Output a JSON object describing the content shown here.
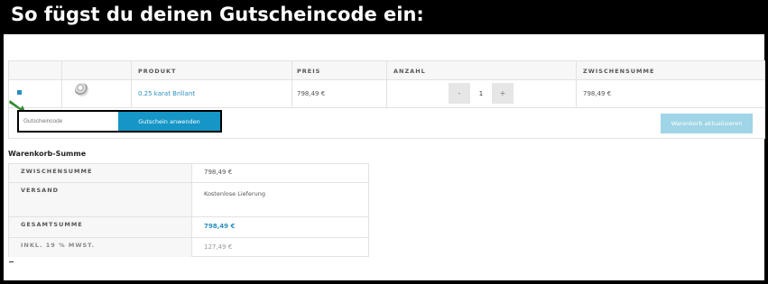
{
  "banner": {
    "text": "So fügst du deinen Gutscheincode ein:"
  },
  "cart": {
    "columns": [
      "PRODUKT",
      "PREIS",
      "ANZAHL",
      "ZWISCHENSUMME"
    ],
    "row": {
      "product": "0.25 karat Brillant",
      "price": "798,49 €",
      "qty_minus": "-",
      "qty_value": "1",
      "qty_plus": "+",
      "subtotal": "798,49 €"
    }
  },
  "coupon": {
    "placeholder": "Gutscheincode",
    "apply_label": "Gutschein anwenden"
  },
  "update_label": "Warenkorb aktualisieren",
  "totals": {
    "title": "Warenkorb-Summe",
    "rows": [
      {
        "label": "ZWISCHENSUMME",
        "value": "798,49 €"
      },
      {
        "label": "VERSAND",
        "value": "Kostenlose Lieferung"
      },
      {
        "label": "GESAMTSUMME",
        "value": "798,49 €"
      },
      {
        "label": "INKL. 19 % MWST.",
        "value": "127,49 €"
      }
    ]
  },
  "colors": {
    "accent": "#1596c7",
    "link": "#2a8fbf",
    "arrow": "#2e8b2e"
  }
}
